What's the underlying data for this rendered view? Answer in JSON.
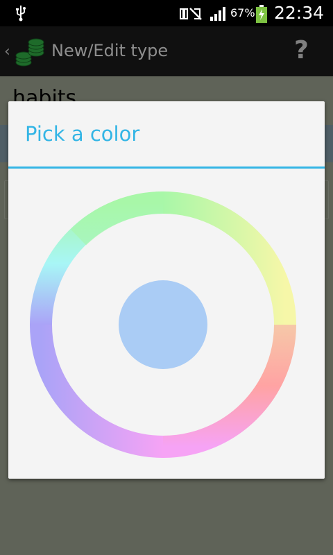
{
  "status_bar": {
    "battery_percent": "67%",
    "time": "22:34",
    "icons": [
      "usb-icon",
      "mute-icon",
      "signal-icon",
      "battery-charging-icon"
    ]
  },
  "action_bar": {
    "title": "New/Edit type",
    "help_label": "?",
    "icons": [
      "back-chevron-icon",
      "coins-logo-icon",
      "help-icon"
    ]
  },
  "background": {
    "name_field_value": "habits"
  },
  "dialog": {
    "title": "Pick a color",
    "accent_color": "#33b5e5",
    "selected_color": "#aaccf5",
    "wheel_colors": [
      "#ffa3a3",
      "#f6a3f5",
      "#aaa3f7",
      "#a8f6f6",
      "#a8f7a8",
      "#f6f7a8"
    ]
  }
}
